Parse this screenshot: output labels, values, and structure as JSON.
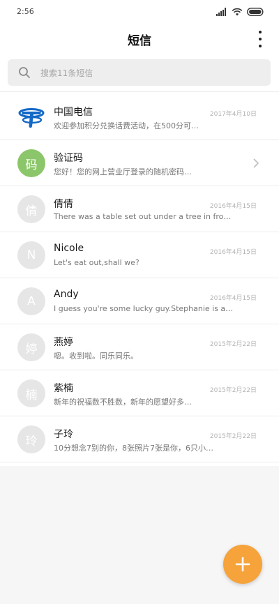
{
  "status_bar": {
    "time": "2:56",
    "icons": [
      "signal-icon",
      "wifi-icon",
      "battery-icon"
    ]
  },
  "header": {
    "title": "短信",
    "more_icon": "more-vertical-icon"
  },
  "search": {
    "placeholder": "搜索11条短信",
    "icon": "search-icon"
  },
  "conversations": [
    {
      "name": "中国电信",
      "preview": "欢迎参加积分兑换话费活动，在500分可…",
      "date": "2017年4月10日",
      "avatar_text": "",
      "avatar_type": "logo"
    },
    {
      "name": "验证码",
      "preview": "您好！您的网上营业厅登录的随机密码…",
      "date": "",
      "avatar_text": "码",
      "avatar_type": "green"
    },
    {
      "name": "倩倩",
      "preview": "There was a table set out under a tree in front o…",
      "date": "2016年4月15日",
      "avatar_text": "倩",
      "avatar_type": "grey"
    },
    {
      "name": "Nicole",
      "preview": "Let's eat out,shall we?",
      "date": "2016年4月15日",
      "avatar_text": "N",
      "avatar_type": "grey"
    },
    {
      "name": "Andy",
      "preview": "I guess you're some lucky guy.Stephanie is a nice girl.",
      "date": "2016年4月15日",
      "avatar_text": "A",
      "avatar_type": "grey"
    },
    {
      "name": "燕婷",
      "preview": "嗯。收到啦。同乐同乐。",
      "date": "2015年2月22日",
      "avatar_text": "婷",
      "avatar_type": "grey"
    },
    {
      "name": "紫楠",
      "preview": "新年的祝福数不胜数，新年的愿望好多…",
      "date": "2015年2月22日",
      "avatar_text": "楠",
      "avatar_type": "grey"
    },
    {
      "name": "子玲",
      "preview": "10分想念7别的你，8张照片7张是你，6只小…",
      "date": "2015年2月22日",
      "avatar_text": "玲",
      "avatar_type": "grey"
    }
  ],
  "fab": {
    "icon": "plus-icon",
    "color": "#f5a33a"
  },
  "colors": {
    "accent": "#f5a33a",
    "green_avatar": "#8cc66a",
    "telecom_blue": "#1468c6"
  }
}
